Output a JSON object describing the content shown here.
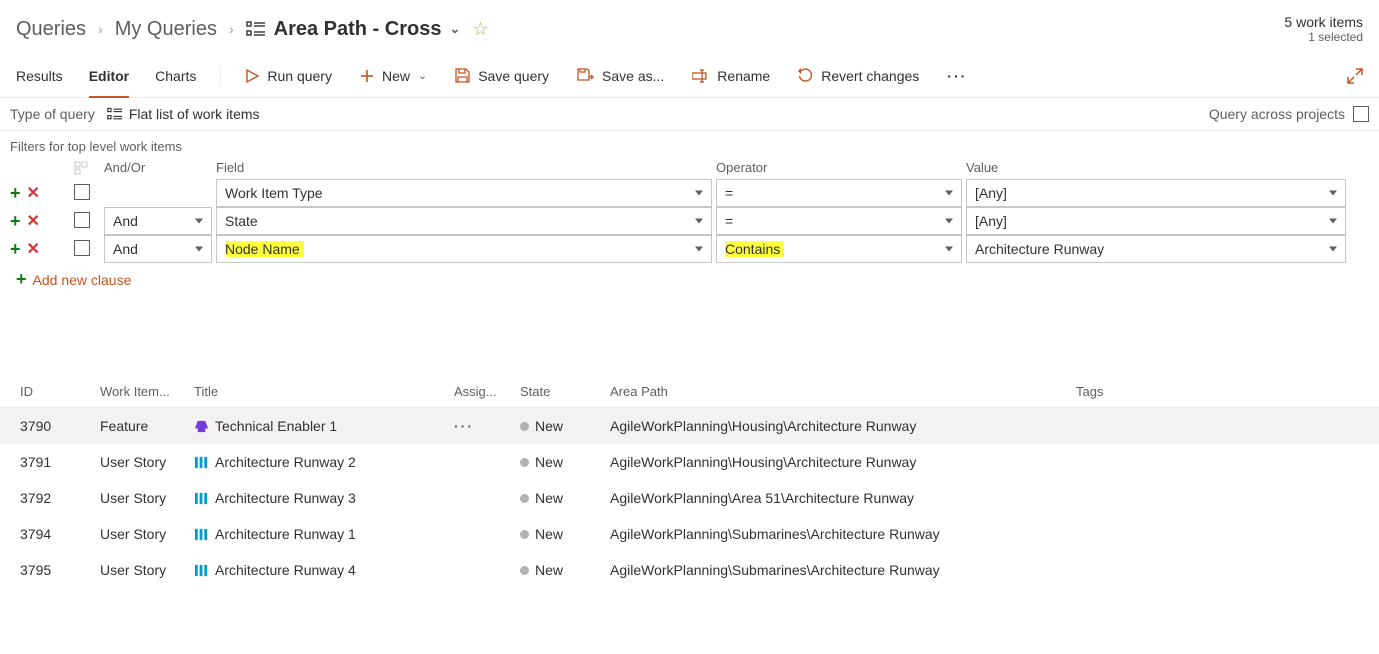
{
  "breadcrumb": {
    "root": "Queries",
    "folder": "My Queries",
    "current": "Area Path - Cross"
  },
  "summary": {
    "count": "5 work items",
    "selected": "1 selected"
  },
  "tabs": {
    "results": "Results",
    "editor": "Editor",
    "charts": "Charts"
  },
  "toolbar": {
    "run": "Run query",
    "new": "New",
    "save": "Save query",
    "saveas": "Save as...",
    "rename": "Rename",
    "revert": "Revert changes"
  },
  "queryType": {
    "label": "Type of query",
    "value": "Flat list of work items",
    "across": "Query across projects"
  },
  "filters": {
    "section": "Filters for top level work items",
    "headers": {
      "andor": "And/Or",
      "field": "Field",
      "operator": "Operator",
      "value": "Value"
    },
    "rows": [
      {
        "andor": "",
        "field": "Work Item Type",
        "operator": "=",
        "value": "[Any]",
        "hl_field": false,
        "hl_op": false
      },
      {
        "andor": "And",
        "field": "State",
        "operator": "=",
        "value": "[Any]",
        "hl_field": false,
        "hl_op": false
      },
      {
        "andor": "And",
        "field": "Node Name",
        "operator": "Contains",
        "value": "Architecture Runway",
        "hl_field": true,
        "hl_op": true
      }
    ],
    "add": "Add new clause"
  },
  "resultsTable": {
    "headers": {
      "id": "ID",
      "type": "Work Item...",
      "title": "Title",
      "assigned": "Assig...",
      "state": "State",
      "area": "Area Path",
      "tags": "Tags"
    },
    "rows": [
      {
        "id": "3790",
        "type": "Feature",
        "icon": "feature",
        "title": "Technical Enabler 1",
        "state": "New",
        "area": "AgileWorkPlanning\\Housing\\Architecture Runway",
        "selected": true
      },
      {
        "id": "3791",
        "type": "User Story",
        "icon": "story",
        "title": "Architecture Runway 2",
        "state": "New",
        "area": "AgileWorkPlanning\\Housing\\Architecture Runway",
        "selected": false
      },
      {
        "id": "3792",
        "type": "User Story",
        "icon": "story",
        "title": "Architecture Runway 3",
        "state": "New",
        "area": "AgileWorkPlanning\\Area 51\\Architecture Runway",
        "selected": false
      },
      {
        "id": "3794",
        "type": "User Story",
        "icon": "story",
        "title": "Architecture Runway 1",
        "state": "New",
        "area": "AgileWorkPlanning\\Submarines\\Architecture Runway",
        "selected": false
      },
      {
        "id": "3795",
        "type": "User Story",
        "icon": "story",
        "title": "Architecture Runway 4",
        "state": "New",
        "area": "AgileWorkPlanning\\Submarines\\Architecture Runway",
        "selected": false
      }
    ]
  }
}
